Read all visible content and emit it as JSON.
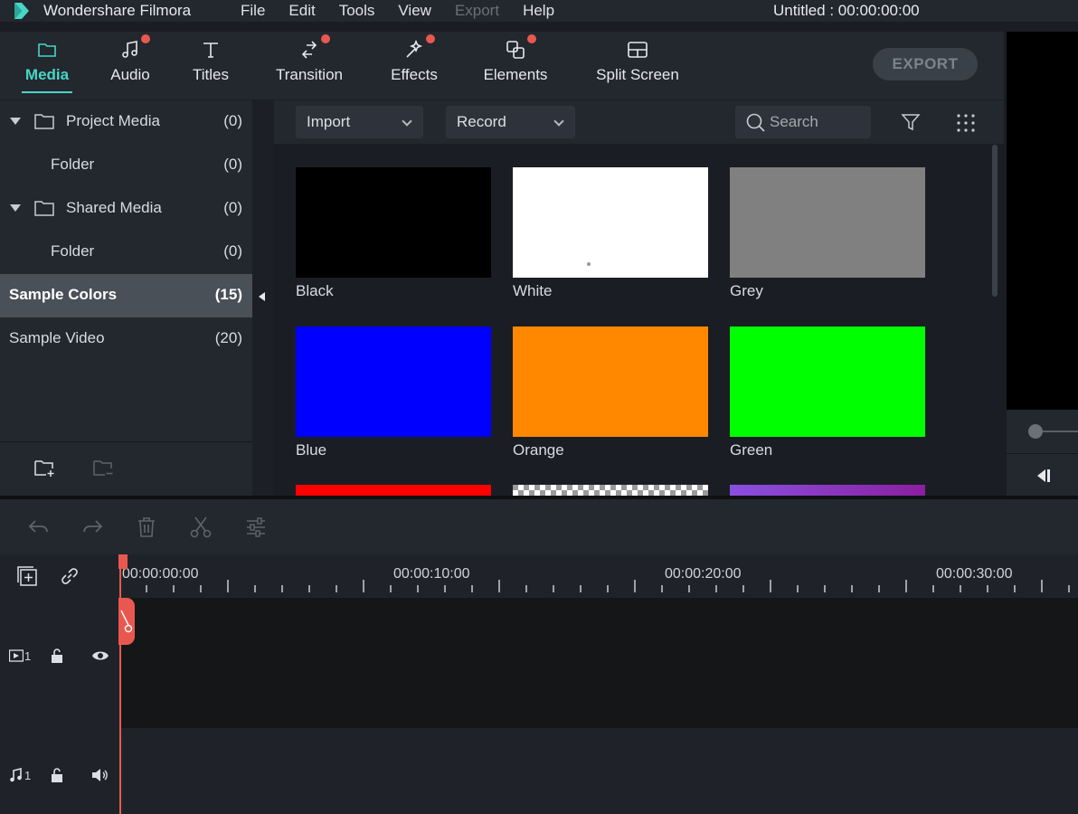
{
  "app": {
    "name": "Wondershare Filmora",
    "document_title": "Untitled : 00:00:00:00",
    "menu": [
      {
        "label": "File",
        "enabled": true
      },
      {
        "label": "Edit",
        "enabled": true
      },
      {
        "label": "Tools",
        "enabled": true
      },
      {
        "label": "View",
        "enabled": true
      },
      {
        "label": "Export",
        "enabled": false
      },
      {
        "label": "Help",
        "enabled": true
      }
    ]
  },
  "tabs": {
    "media": {
      "label": "Media",
      "active": true
    },
    "audio": {
      "label": "Audio",
      "badge": true
    },
    "titles": {
      "label": "Titles"
    },
    "transition": {
      "label": "Transition",
      "badge": true
    },
    "effects": {
      "label": "Effects",
      "badge": true
    },
    "elements": {
      "label": "Elements",
      "badge": true
    },
    "split_screen": {
      "label": "Split Screen"
    }
  },
  "export_button": {
    "label": "EXPORT"
  },
  "sidebar": {
    "project_media": {
      "label": "Project Media",
      "count": "(0)"
    },
    "project_folder": {
      "label": "Folder",
      "count": "(0)"
    },
    "shared_media": {
      "label": "Shared Media",
      "count": "(0)"
    },
    "shared_folder": {
      "label": "Folder",
      "count": "(0)"
    },
    "sample_colors": {
      "label": "Sample Colors",
      "count": "(15)",
      "selected": true
    },
    "sample_video": {
      "label": "Sample Video",
      "count": "(20)"
    }
  },
  "media_toolbar": {
    "import_label": "Import",
    "record_label": "Record",
    "search_placeholder": "Search"
  },
  "media_items": [
    {
      "label": "Black",
      "color": "#000000"
    },
    {
      "label": "White",
      "color": "#ffffff"
    },
    {
      "label": "Grey",
      "color": "#808080"
    },
    {
      "label": "Blue",
      "color": "#0000ff"
    },
    {
      "label": "Orange",
      "color": "#ff8800"
    },
    {
      "label": "Green",
      "color": "#00ff00"
    },
    {
      "label": "",
      "color": "#ff0000"
    },
    {
      "label": "",
      "color": "checkerboard"
    },
    {
      "label": "",
      "color": "#8a4fe0"
    }
  ],
  "timeline": {
    "ruler": [
      "00:00:00:00",
      "00:00:10:00",
      "00:00:20:00",
      "00:00:30:00"
    ],
    "video_track": {
      "number": "1"
    },
    "audio_track": {
      "number": "1"
    }
  },
  "colors": {
    "accent": "#48d6c6",
    "badge": "#e9584f",
    "playhead": "#e9584f"
  }
}
